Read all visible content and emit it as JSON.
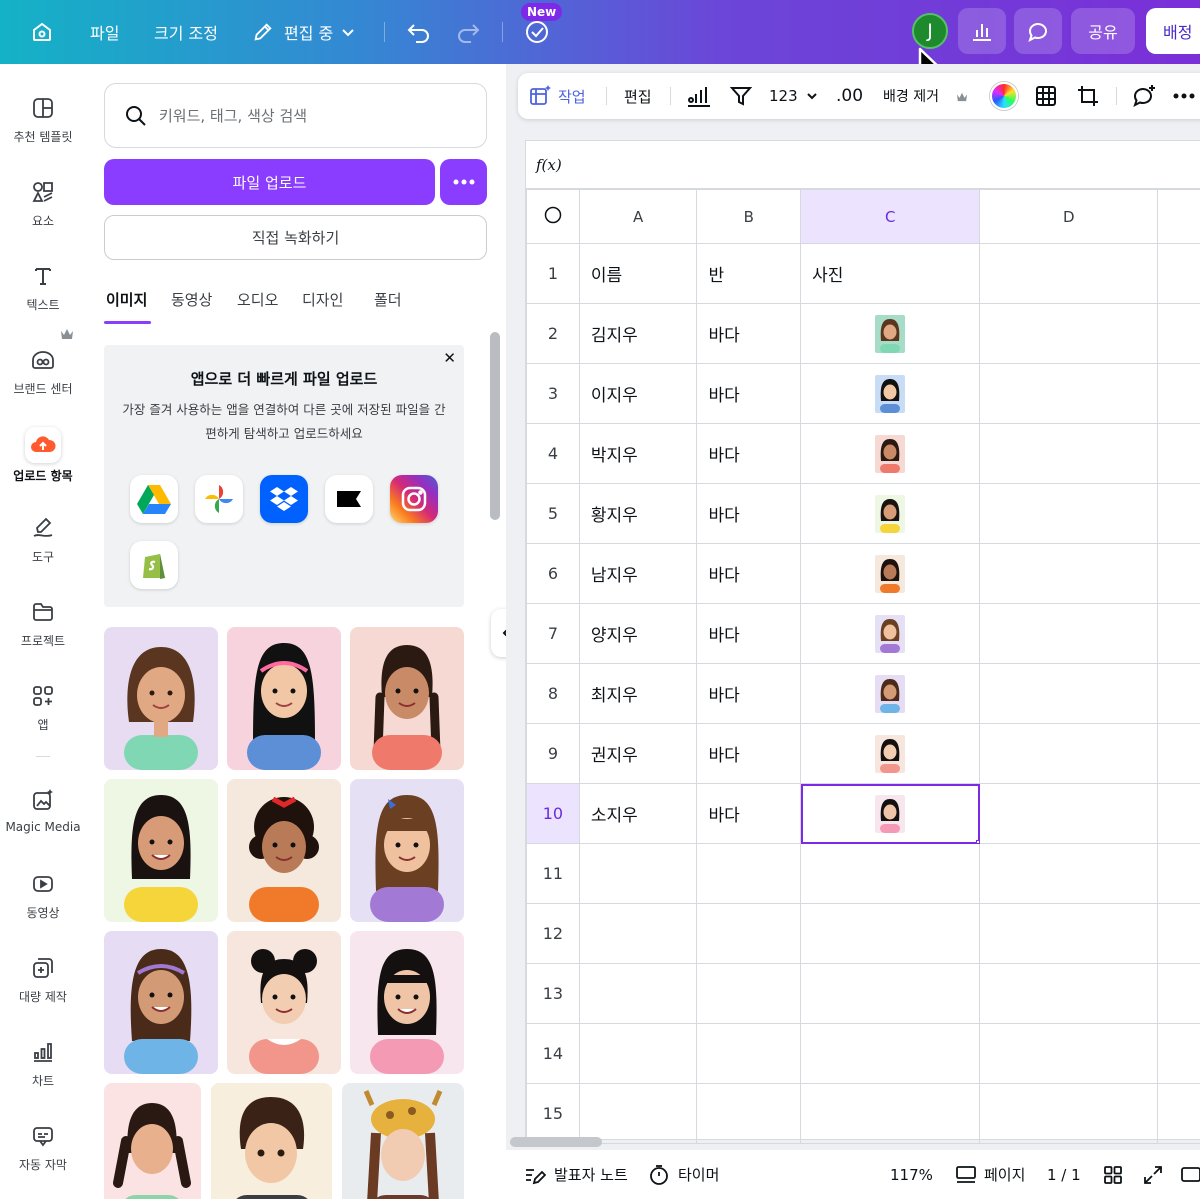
{
  "topbar": {
    "file": "파일",
    "resize": "크기 조정",
    "editing": "편집 중",
    "new_badge": "New",
    "avatar_initial": "J",
    "share": "공유",
    "publish": "배정"
  },
  "rail": {
    "items": [
      {
        "label": "추천 템플릿",
        "icon": "template-icon"
      },
      {
        "label": "요소",
        "icon": "elements-icon"
      },
      {
        "label": "텍스트",
        "icon": "text-icon"
      },
      {
        "label": "브랜드 센터",
        "icon": "brand-icon"
      },
      {
        "label": "업로드 항목",
        "icon": "upload-cloud-icon"
      },
      {
        "label": "도구",
        "icon": "draw-icon"
      },
      {
        "label": "프로젝트",
        "icon": "folder-icon"
      },
      {
        "label": "앱",
        "icon": "apps-icon"
      },
      {
        "label": "Magic Media",
        "icon": "magic-media-icon"
      },
      {
        "label": "동영상",
        "icon": "video-icon"
      },
      {
        "label": "대량 제작",
        "icon": "bulk-create-icon"
      },
      {
        "label": "차트",
        "icon": "chart-icon"
      },
      {
        "label": "자동 자막",
        "icon": "captions-icon"
      }
    ]
  },
  "panel": {
    "search_placeholder": "키워드, 태그, 색상 검색",
    "upload_button": "파일 업로드",
    "record_button": "직접 녹화하기",
    "tabs": [
      "이미지",
      "동영상",
      "오디오",
      "디자인",
      "폴더"
    ],
    "promo": {
      "title": "앱으로 더 빠르게 파일 업로드",
      "body": "가장 즐겨 사용하는 앱을 연결하여 다른 곳에 저장된 파일을 간편하게 탐색하고 업로드하세요",
      "apps": [
        "google-drive-icon",
        "google-photos-icon",
        "dropbox-icon",
        "box-icon",
        "instagram-icon",
        "shopify-icon"
      ]
    }
  },
  "toolbar": {
    "work": "작업",
    "edit": "편집",
    "number_format": "123",
    "decimal": ".00",
    "remove_bg": "배경 제거"
  },
  "sheet": {
    "formula_label": "f(x)",
    "columns": [
      "A",
      "B",
      "C",
      "D"
    ],
    "rows": [
      {
        "num": "1",
        "a": "이름",
        "b": "반",
        "c": "사진"
      },
      {
        "num": "2",
        "a": "김지우",
        "b": "바다"
      },
      {
        "num": "3",
        "a": "이지우",
        "b": "바다"
      },
      {
        "num": "4",
        "a": "박지우",
        "b": "바다"
      },
      {
        "num": "5",
        "a": "황지우",
        "b": "바다"
      },
      {
        "num": "6",
        "a": "남지우",
        "b": "바다"
      },
      {
        "num": "7",
        "a": "양지우",
        "b": "바다"
      },
      {
        "num": "8",
        "a": "최지우",
        "b": "바다"
      },
      {
        "num": "9",
        "a": "권지우",
        "b": "바다"
      },
      {
        "num": "10",
        "a": "소지우",
        "b": "바다"
      },
      {
        "num": "11",
        "a": "",
        "b": ""
      },
      {
        "num": "12",
        "a": "",
        "b": ""
      },
      {
        "num": "13",
        "a": "",
        "b": ""
      },
      {
        "num": "14",
        "a": "",
        "b": ""
      },
      {
        "num": "15",
        "a": "",
        "b": ""
      }
    ]
  },
  "bottombar": {
    "notes": "발표자 노트",
    "timer": "타이머",
    "zoom": "117%",
    "pages": "페이지",
    "page_count": "1 / 1"
  },
  "colors": {
    "accent": "#8b3dff",
    "selection": "#7d2ae8",
    "avatar": "#1d8a2e"
  }
}
